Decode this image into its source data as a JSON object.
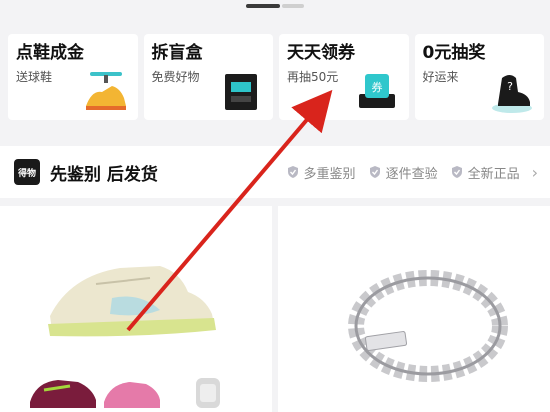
{
  "promos": [
    {
      "title": "点鞋成金",
      "subtitle": "送球鞋",
      "icon": "drone-shoe-icon"
    },
    {
      "title": "拆盲盒",
      "subtitle": "免费好物",
      "icon": "blind-box-icon"
    },
    {
      "title": "天天领券",
      "subtitle": "再抽50元",
      "icon": "coupon-icon"
    },
    {
      "title": "0元抽奖",
      "subtitle": "好运来",
      "icon": "mystery-shoe-icon"
    }
  ],
  "auth_bar": {
    "logo_text": "得物",
    "title": "先鉴别 后发货",
    "features": [
      "多重鉴别",
      "逐件查验",
      "全新正品"
    ]
  },
  "products": [
    {
      "name": "sneaker-product",
      "icon": "sneaker-icon"
    },
    {
      "name": "bracelet-product",
      "icon": "bracelet-icon"
    }
  ],
  "colors": {
    "annotation_arrow": "#d9241c"
  }
}
